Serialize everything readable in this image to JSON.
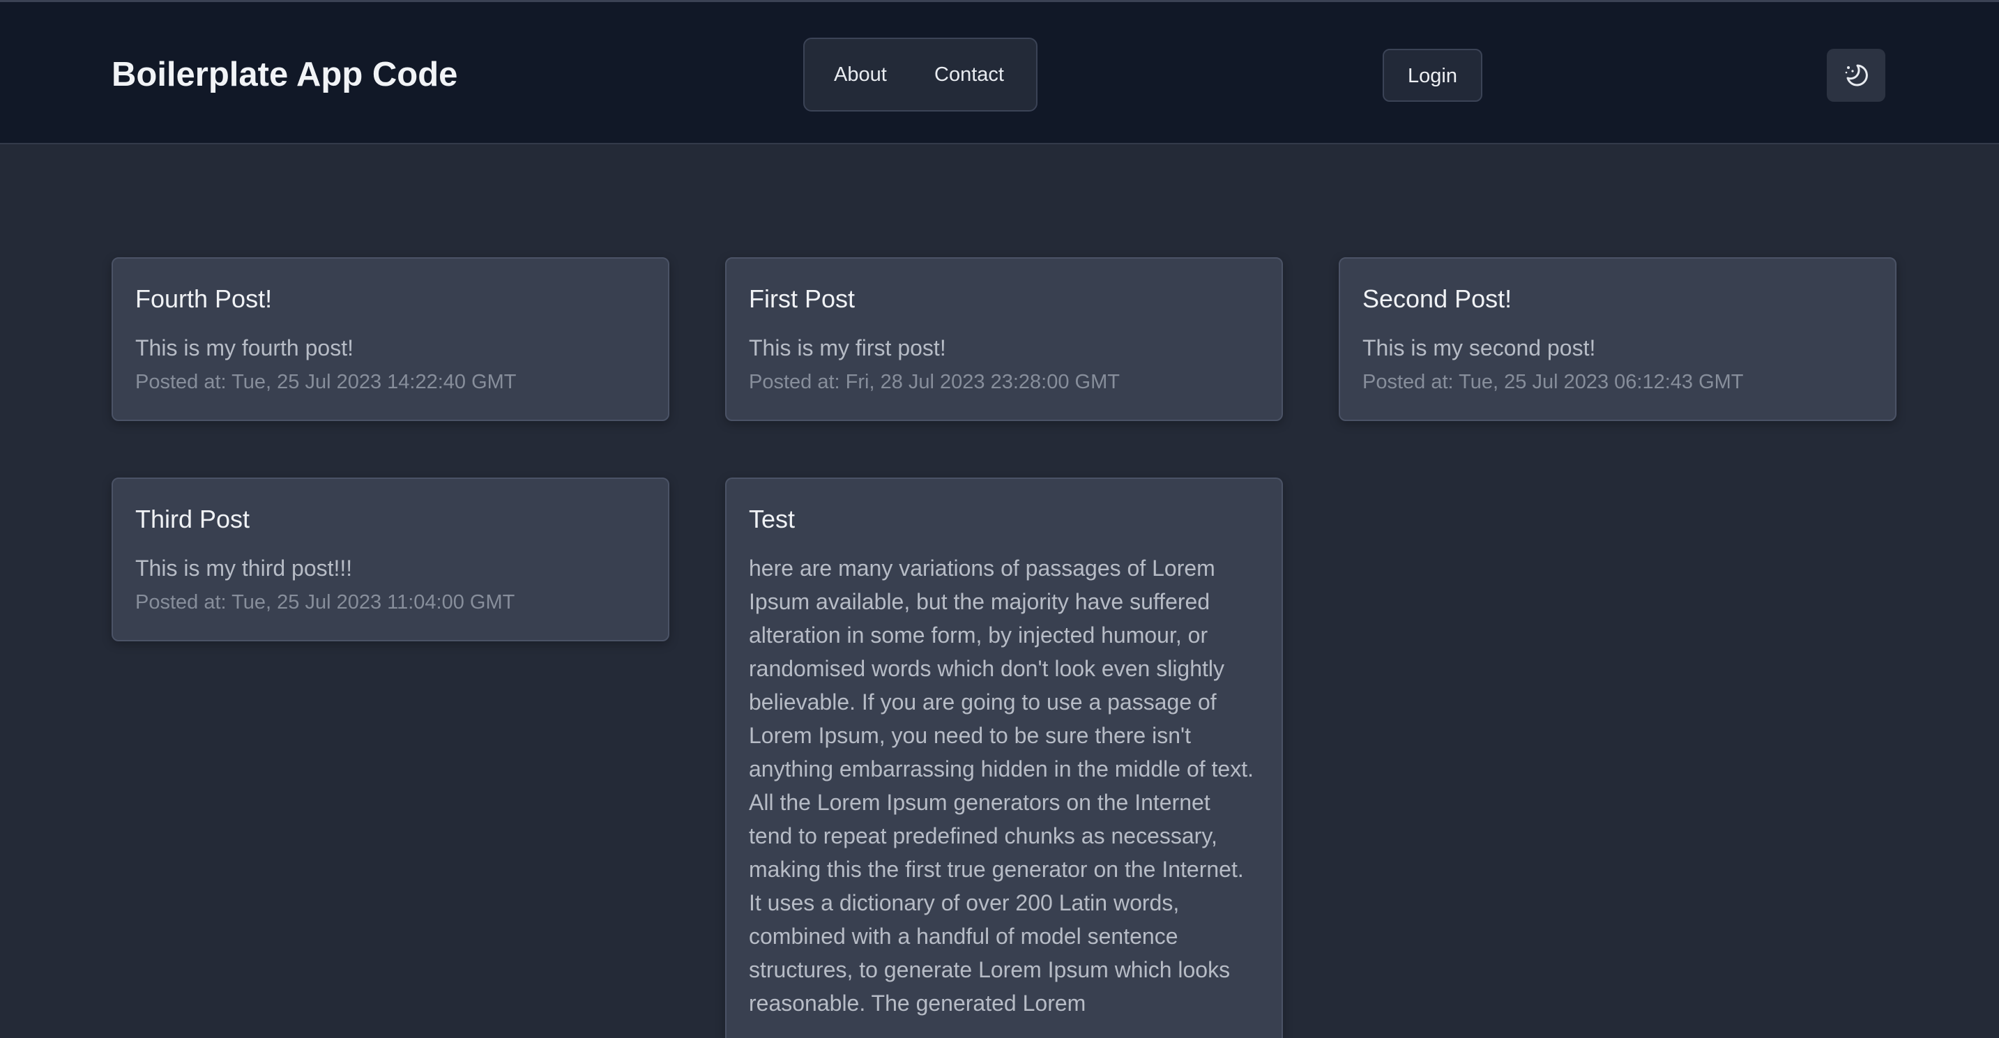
{
  "header": {
    "brand": "Boilerplate App Code",
    "nav": {
      "about_label": "About",
      "contact_label": "Contact"
    },
    "login_label": "Login",
    "theme_toggle_icon": "moon-stars-icon"
  },
  "posts": [
    {
      "title": "Fourth Post!",
      "body": "This is my fourth post!",
      "posted_at": "Posted at: Tue, 25 Jul 2023 14:22:40 GMT"
    },
    {
      "title": "First Post",
      "body": "This is my first post!",
      "posted_at": "Posted at: Fri, 28 Jul 2023 23:28:00 GMT"
    },
    {
      "title": "Second Post!",
      "body": "This is my second post!",
      "posted_at": "Posted at: Tue, 25 Jul 2023 06:12:43 GMT"
    },
    {
      "title": "Third Post",
      "body": "This is my third post!!!",
      "posted_at": "Posted at: Tue, 25 Jul 2023 11:04:00 GMT"
    },
    {
      "title": "Test",
      "body": "here are many variations of passages of Lorem Ipsum available, but the majority have suffered alteration in some form, by injected humour, or randomised words which don't look even slightly believable. If you are going to use a passage of Lorem Ipsum, you need to be sure there isn't anything embarrassing hidden in the middle of text. All the Lorem Ipsum generators on the Internet tend to repeat predefined chunks as necessary, making this the first true generator on the Internet. It uses a dictionary of over 200 Latin words, combined with a handful of model sentence structures, to generate Lorem Ipsum which looks reasonable. The generated Lorem"
    }
  ]
}
